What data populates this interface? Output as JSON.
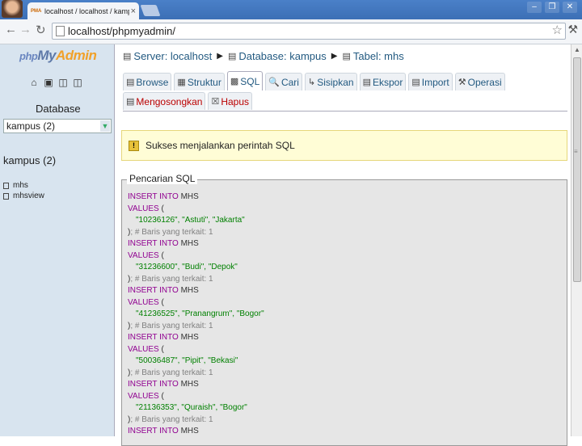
{
  "browser": {
    "tab_title": "localhost / localhost / kampus",
    "tab_favicon": "PMA",
    "close_glyph": "×",
    "url": "localhost/phpmyadmin/",
    "window_controls": [
      "–",
      "❐",
      "✕"
    ]
  },
  "sidebar": {
    "logo_php": "php",
    "logo_my": "My",
    "logo_admin": "Admin",
    "quick_icons": [
      "home-icon",
      "logout-icon",
      "query-window-icon",
      "documentation-icon"
    ],
    "database_label": "Database",
    "database_select_value": "kampus (2)",
    "db_title": "kampus (2)",
    "tables": [
      "mhs",
      "mhsview"
    ]
  },
  "breadcrumb": {
    "server": "Server: localhost",
    "database": "Database: kampus",
    "table": "Tabel: mhs"
  },
  "tabs_row1": [
    "Browse",
    "Struktur",
    "SQL",
    "Cari",
    "Sisipkan",
    "Ekspor",
    "Import",
    "Operasi"
  ],
  "tabs_row2": [
    "Mengosongkan",
    "Hapus"
  ],
  "active_tab": "SQL",
  "success_message": "Sukses menjalankan perintah SQL",
  "sql_legend": "Pencarian SQL",
  "sql_lines": [
    {
      "kw": "INSERT INTO",
      "pl": " MHS"
    },
    {
      "kw": "VALUES",
      "pl": " ("
    },
    {
      "ind": true,
      "str": "\"10236126\", \"Astuti\", \"Jakarta\""
    },
    {
      "pl": ")",
      "cm": "; # Baris yang terkait: 1"
    },
    {
      "kw": "INSERT INTO",
      "pl": " MHS"
    },
    {
      "kw": "VALUES",
      "pl": " ("
    },
    {
      "ind": true,
      "str": "\"31236600\", \"Budi\", \"Depok\""
    },
    {
      "pl": ")",
      "cm": "; # Baris yang terkait: 1"
    },
    {
      "kw": "INSERT INTO",
      "pl": " MHS"
    },
    {
      "kw": "VALUES",
      "pl": " ("
    },
    {
      "ind": true,
      "str": "\"41236525\", \"Pranangrum\", \"Bogor\""
    },
    {
      "pl": ")",
      "cm": "; # Baris yang terkait: 1"
    },
    {
      "kw": "INSERT INTO",
      "pl": " MHS"
    },
    {
      "kw": "VALUES",
      "pl": " ("
    },
    {
      "ind": true,
      "str": "\"50036487\", \"Pipit\", \"Bekasi\""
    },
    {
      "pl": ")",
      "cm": "; # Baris yang terkait: 1"
    },
    {
      "kw": "INSERT INTO",
      "pl": " MHS"
    },
    {
      "kw": "VALUES",
      "pl": " ("
    },
    {
      "ind": true,
      "str": "\"21136353\", \"Quraish\", \"Bogor\""
    },
    {
      "pl": ")",
      "cm": "; # Baris yang terkait: 1"
    },
    {
      "kw": "INSERT INTO",
      "pl": " MHS"
    }
  ]
}
